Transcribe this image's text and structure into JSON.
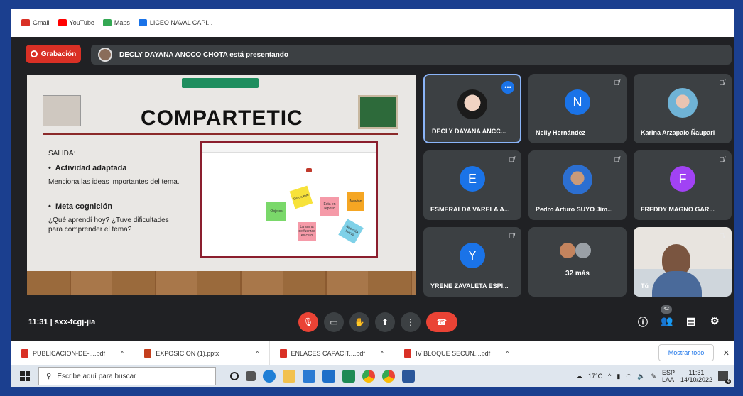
{
  "bookmarks": [
    {
      "label": "Gmail",
      "icon": "gmail-icon",
      "color": "#d93025"
    },
    {
      "label": "YouTube",
      "icon": "youtube-icon",
      "color": "#ff0000"
    },
    {
      "label": "Maps",
      "icon": "maps-icon",
      "color": "#34a853"
    },
    {
      "label": "LICEO NAVAL CAPI...",
      "icon": "classroom-icon",
      "color": "#1a73e8"
    }
  ],
  "meet": {
    "recording_label": "Grabación",
    "presenting_text": "DECLY DAYANA ANCCO CHOTA está presentando",
    "time": "11:31",
    "separator": "|",
    "meeting_code": "sxx-fcgj-jia",
    "participant_count": "42"
  },
  "slide": {
    "title": "COMPARTETIC",
    "salida": "SALIDA:",
    "activity_title": "Actividad adaptada",
    "activity_text": "Menciona las ideas importantes del tema.",
    "meta_title": "Meta cognición",
    "meta_text": "¿Qué aprendí hoy? ¿Tuve dificultades para comprender el tema?",
    "bullet": "•",
    "notes": [
      "Esta en reposo",
      "Se mueve",
      "Necesita fuerza",
      "La suma de fuerzas es cero",
      "Objetos",
      "Newton"
    ]
  },
  "tiles": [
    {
      "name": "DECLY DAYANA ANCC...",
      "avatar": "photo",
      "active": true,
      "more": "•••"
    },
    {
      "name": "Nelly Hernández",
      "avatar": "N",
      "color": "#1a73e8"
    },
    {
      "name": "Karina Arzapalo Ñaupari",
      "avatar": "photo"
    },
    {
      "name": "ESMERALDA VARELA A...",
      "avatar": "E",
      "color": "#1a73e8"
    },
    {
      "name": "Pedro Arturo SUYO Jim...",
      "avatar": "photo"
    },
    {
      "name": "FREDDY MAGNO GAR...",
      "avatar": "F",
      "color": "#a142f4"
    },
    {
      "name": "YRENE ZAVALETA ESPI...",
      "avatar": "Y",
      "color": "#1a73e8"
    },
    {
      "name": "32 más",
      "avatar": "group"
    },
    {
      "name": "Tú",
      "avatar": "video"
    }
  ],
  "downloads": [
    {
      "name": "PUBLICACION-DE-....pdf",
      "type": "pdf"
    },
    {
      "name": "EXPOSICION (1).pptx",
      "type": "pptx"
    },
    {
      "name": "ENLACES CAPACIT....pdf",
      "type": "pdf"
    },
    {
      "name": "IV BLOQUE SECUN....pdf",
      "type": "pdf"
    }
  ],
  "downloads_show_all": "Mostrar todo",
  "taskbar": {
    "search_placeholder": "Escribe aquí para buscar",
    "temperature": "17°C",
    "lang_top": "ESP",
    "lang_bottom": "LAA",
    "clock_time": "11:31",
    "clock_date": "14/10/2022",
    "notifications": "4"
  },
  "colors": {
    "meet_bg": "#202124",
    "tile_bg": "#3c4043",
    "end_call": "#ea4335",
    "frame": "#1b3f8f"
  }
}
